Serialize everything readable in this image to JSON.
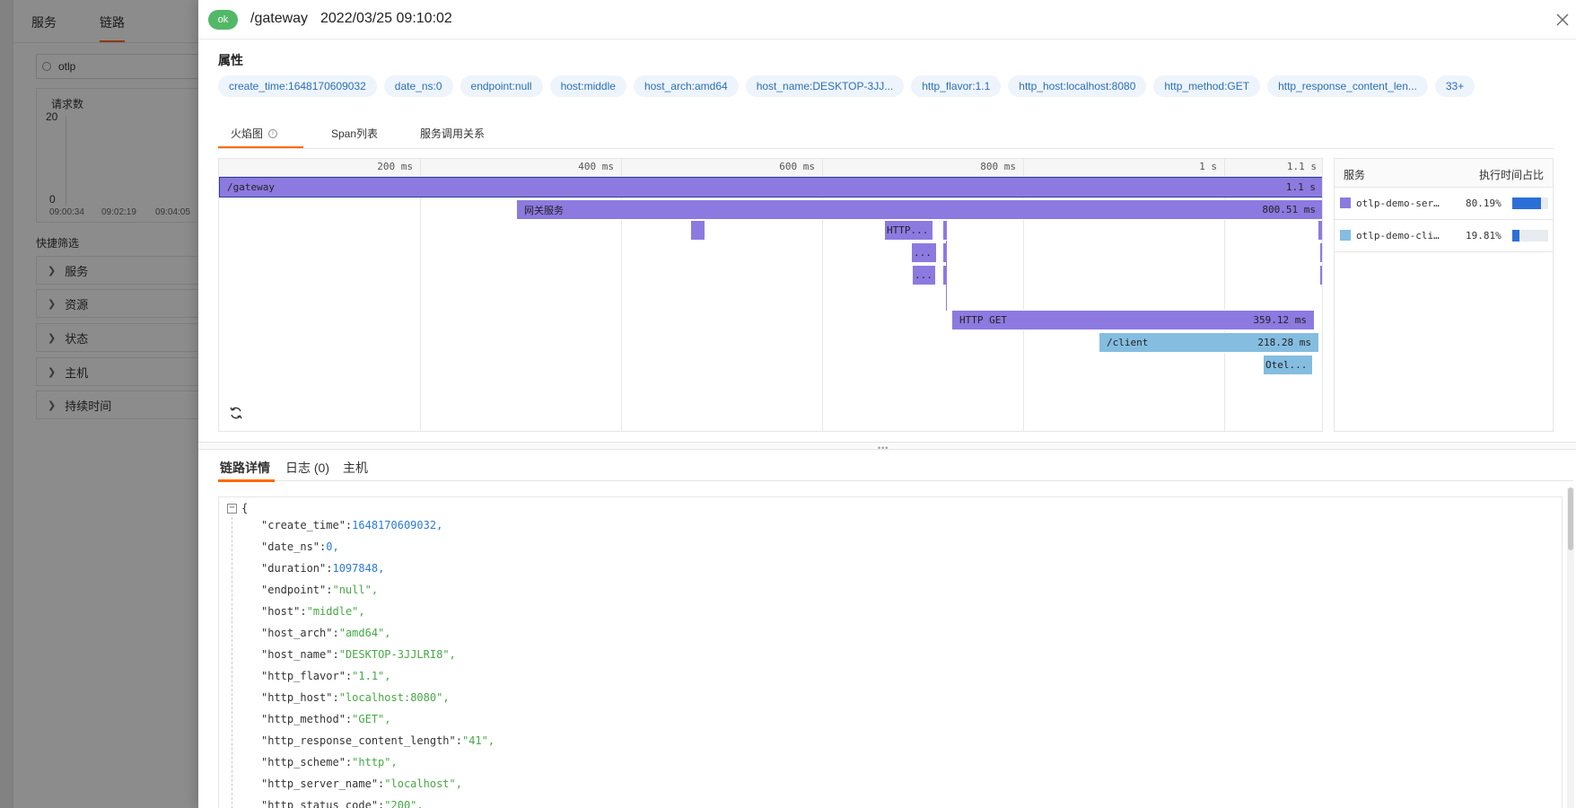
{
  "background": {
    "tabs": [
      {
        "label": "服务"
      },
      {
        "label": "链路"
      }
    ],
    "search_value": "otlp",
    "chart": {
      "title": "请求数",
      "y_max": "20",
      "y_min": "0",
      "x_labels": [
        "09:00:34",
        "09:02:19",
        "09:04:05"
      ]
    },
    "quick_filter_title": "快捷筛选",
    "filters": [
      {
        "label": "服务"
      },
      {
        "label": "资源"
      },
      {
        "label": "状态"
      },
      {
        "label": "主机"
      },
      {
        "label": "持续时间"
      }
    ]
  },
  "header": {
    "status": "ok",
    "status_color": "#52b868",
    "title": "/gateway",
    "time": "2022/03/25 09:10:02"
  },
  "attributes": {
    "title": "属性",
    "tags": [
      "create_time:1648170609032",
      "date_ns:0",
      "endpoint:null",
      "host:middle",
      "host_arch:amd64",
      "host_name:DESKTOP-3JJ...",
      "http_flavor:1.1",
      "http_host:localhost:8080",
      "http_method:GET",
      "http_response_content_len...",
      "33+"
    ]
  },
  "flame_tabs": [
    {
      "label": "火焰图"
    },
    {
      "label": "Span列表"
    },
    {
      "label": "服务调用关系"
    }
  ],
  "flame": {
    "axis_ticks": [
      "200 ms",
      "400 ms",
      "600 ms",
      "800 ms",
      "1 s",
      "1.1 s"
    ],
    "spans": [
      {
        "label": "/gateway",
        "duration": "1.1 s",
        "color": "#8c7ae0"
      },
      {
        "label": "网关服务",
        "duration": "800.51 ms",
        "color": "#8c7ae0"
      },
      {
        "label": "",
        "duration": "",
        "color": "#8c7ae0"
      },
      {
        "label": "HTTP...",
        "duration": "",
        "color": "#8c7ae0"
      },
      {
        "label": "...",
        "duration": "",
        "color": "#8c7ae0"
      },
      {
        "label": "...",
        "duration": "",
        "color": "#8c7ae0"
      },
      {
        "label": "HTTP GET",
        "duration": "359.12 ms",
        "color": "#8c7ae0"
      },
      {
        "label": "/client",
        "duration": "218.28 ms",
        "color": "#84bde0"
      },
      {
        "label": "Otel...",
        "duration": "",
        "color": "#84bde0"
      }
    ]
  },
  "services": {
    "header_service": "服务",
    "header_ratio": "执行时间占比",
    "rows": [
      {
        "name": "otlp-demo-ser…",
        "percent": "80.19%",
        "ratio": 0.8019,
        "color": "#8c7ae0"
      },
      {
        "name": "otlp-demo-cli…",
        "percent": "19.81%",
        "ratio": 0.1981,
        "color": "#84bde0"
      }
    ]
  },
  "detail_tabs": [
    {
      "label": "链路详情"
    },
    {
      "label": "日志 (0)"
    },
    {
      "label": "主机"
    }
  ],
  "json_detail": {
    "open_brace": "{",
    "lines": [
      {
        "key": "\"create_time\"",
        "value": "1648170609032",
        "type": "num"
      },
      {
        "key": "\"date_ns\"",
        "value": "0",
        "type": "num"
      },
      {
        "key": "\"duration\"",
        "value": "1097848",
        "type": "num"
      },
      {
        "key": "\"endpoint\"",
        "value": "\"null\"",
        "type": "str"
      },
      {
        "key": "\"host\"",
        "value": "\"middle\"",
        "type": "str"
      },
      {
        "key": "\"host_arch\"",
        "value": "\"amd64\"",
        "type": "str"
      },
      {
        "key": "\"host_name\"",
        "value": "\"DESKTOP-3JJLRI8\"",
        "type": "str"
      },
      {
        "key": "\"http_flavor\"",
        "value": "\"1.1\"",
        "type": "str"
      },
      {
        "key": "\"http_host\"",
        "value": "\"localhost:8080\"",
        "type": "str"
      },
      {
        "key": "\"http_method\"",
        "value": "\"GET\"",
        "type": "str"
      },
      {
        "key": "\"http_response_content_length\"",
        "value": "\"41\"",
        "type": "str"
      },
      {
        "key": "\"http_scheme\"",
        "value": "\"http\"",
        "type": "str"
      },
      {
        "key": "\"http_server_name\"",
        "value": "\"localhost\"",
        "type": "str"
      },
      {
        "key": "\"http_status_code\"",
        "value": "\"200\"",
        "type": "str"
      }
    ]
  }
}
